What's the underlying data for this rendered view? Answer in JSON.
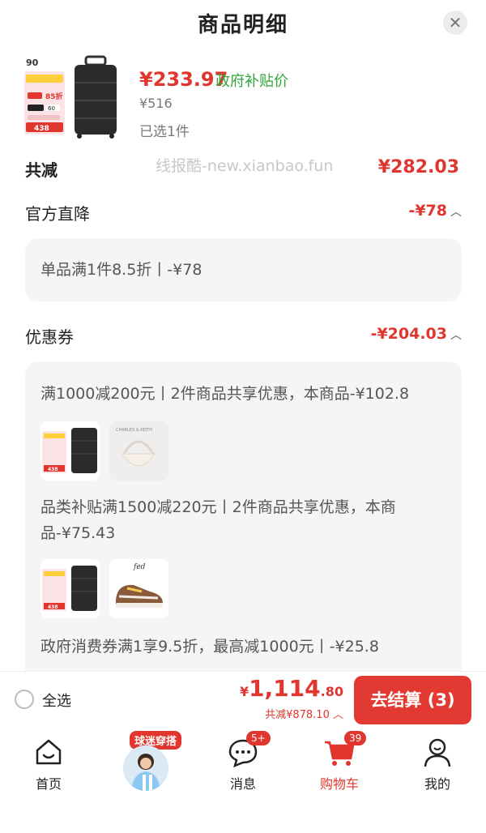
{
  "header": {
    "title": "商品明细",
    "close_icon": "close-icon"
  },
  "product": {
    "price": "¥233.97",
    "price_label": "政府补贴价",
    "original_price": "¥516",
    "selected": "已选1件",
    "thumb_texts": {
      "promo": "85折",
      "badge_num": "438",
      "official": "官方直降",
      "coupon": "补贴券",
      "off": "60"
    }
  },
  "watermark": "线报酷-new.xianbao.fun",
  "total": {
    "label": "共减",
    "value": "¥282.03"
  },
  "official": {
    "title": "官方直降",
    "value": "-¥78",
    "detail": "单品满1件8.5折丨-¥78"
  },
  "coupons": {
    "title": "优惠券",
    "value": "-¥204.03",
    "items": [
      {
        "text": "满1000减200元丨2件商品共享优惠，本商品-¥102.8",
        "second_thumb": "bag",
        "bag_brand": "CHARLES & KEITH"
      },
      {
        "text_line1": "品类补贴满1500减220元丨2件商品共享优惠，本商",
        "text_line2": "品-¥75.43",
        "second_thumb": "shoe",
        "shoe_brand": "fed"
      },
      {
        "text": "政府消费券满1享9.5折，最高减1000元丨-¥25.8"
      }
    ]
  },
  "checkout": {
    "select_all": "全选",
    "currency": "¥",
    "total_int": "1,114",
    "total_dec": ".80",
    "saved": "共减¥878.10",
    "pay_button": "去结算 (3)"
  },
  "tabbar": {
    "tabs": [
      {
        "label": "首页",
        "icon": "home-icon"
      },
      {
        "label": "",
        "icon": "avatar",
        "badge": "球迷穿搭"
      },
      {
        "label": "消息",
        "icon": "message-icon",
        "badge": "5+"
      },
      {
        "label": "购物车",
        "icon": "cart-icon",
        "badge": "39"
      },
      {
        "label": "我的",
        "icon": "profile-icon"
      }
    ]
  },
  "colors": {
    "accent": "#e0362d",
    "green": "#2fa63b"
  }
}
